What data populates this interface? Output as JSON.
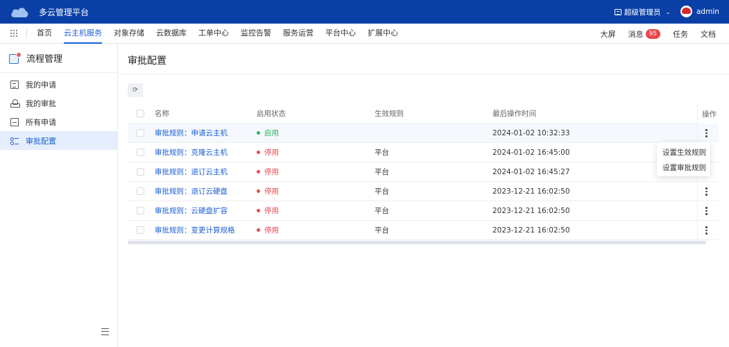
{
  "header": {
    "app_title": "多云管理平台",
    "role_label": "超级管理员",
    "username": "admin"
  },
  "nav": {
    "items": [
      "首页",
      "云主机服务",
      "对象存储",
      "云数据库",
      "工单中心",
      "监控告警",
      "服务运营",
      "平台中心",
      "扩展中心"
    ],
    "active_index": 1,
    "right": {
      "screen": "大屏",
      "messages": "消息",
      "message_count": "95",
      "tasks": "任务",
      "docs": "文档"
    }
  },
  "sidebar": {
    "title": "流程管理",
    "items": [
      "我的申请",
      "我的审批",
      "所有申请",
      "审批配置"
    ],
    "active_index": 3
  },
  "main": {
    "page_title": "审批配置",
    "columns": {
      "name": "名称",
      "status": "启用状态",
      "rule": "生效规则",
      "time": "最后操作时间",
      "op": "操作"
    },
    "rows": [
      {
        "name": "审批规则：申请云主机",
        "status": "启用",
        "rule": "",
        "time": "2024-01-02 10:32:33"
      },
      {
        "name": "审批规则：克隆云主机",
        "status": "停用",
        "rule": "平台",
        "time": "2024-01-02 16:45:00"
      },
      {
        "name": "审批规则：退订云主机",
        "status": "停用",
        "rule": "平台",
        "time": "2024-01-02 16:45:27"
      },
      {
        "name": "审批规则：退订云硬盘",
        "status": "停用",
        "rule": "平台",
        "time": "2023-12-21 16:02:50"
      },
      {
        "name": "审批规则：云硬盘扩容",
        "status": "停用",
        "rule": "平台",
        "time": "2023-12-21 16:02:50"
      },
      {
        "name": "审批规则：变更计算规格",
        "status": "停用",
        "rule": "平台",
        "time": "2023-12-21 16:02:50"
      }
    ],
    "dropdown": [
      "设置生效规则",
      "设置审批规则"
    ]
  },
  "colors": {
    "header_bg": "#0a40a6",
    "accent": "#1b5fd4",
    "enabled": "#2db55d",
    "disabled": "#e8474c"
  }
}
